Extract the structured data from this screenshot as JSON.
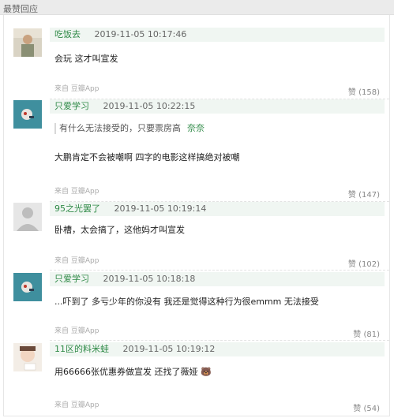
{
  "header": {
    "title": "最赞回应"
  },
  "comments": [
    {
      "username": "吃饭去",
      "time": "2019-11-05 10:17:46",
      "quote": null,
      "quote_author": null,
      "content": "会玩 这才叫宣发",
      "source": "来自 豆瓣App",
      "likes": "赞 (158)"
    },
    {
      "username": "只爱学习",
      "time": "2019-11-05 10:22:15",
      "quote": "有什么无法接受的，只要票房高",
      "quote_author": "奈奈",
      "content": "大鹏肯定不会被嘲啊 四字的电影这样搞绝对被嘲",
      "source": "来自 豆瓣App",
      "likes": "赞 (147)"
    },
    {
      "username": "95之光罢了",
      "time": "2019-11-05 10:19:14",
      "quote": null,
      "quote_author": null,
      "content": "卧槽，太会搞了，这他妈才叫宣发",
      "source": "来自 豆瓣App",
      "likes": "赞 (102)"
    },
    {
      "username": "只爱学习",
      "time": "2019-11-05 10:18:18",
      "quote": null,
      "quote_author": null,
      "content": "...吓到了 多亏少年的你没有 我还是觉得这种行为很emmm 无法接受",
      "source": "来自 豆瓣App",
      "likes": "赞 (81)"
    },
    {
      "username": "11区的料米蛙",
      "time": "2019-11-05 10:19:12",
      "quote": null,
      "quote_author": null,
      "content": "用66666张优惠券做宣发 还找了薇娅 🐻",
      "source": "来自 豆瓣App",
      "likes": "赞 (54)"
    }
  ]
}
